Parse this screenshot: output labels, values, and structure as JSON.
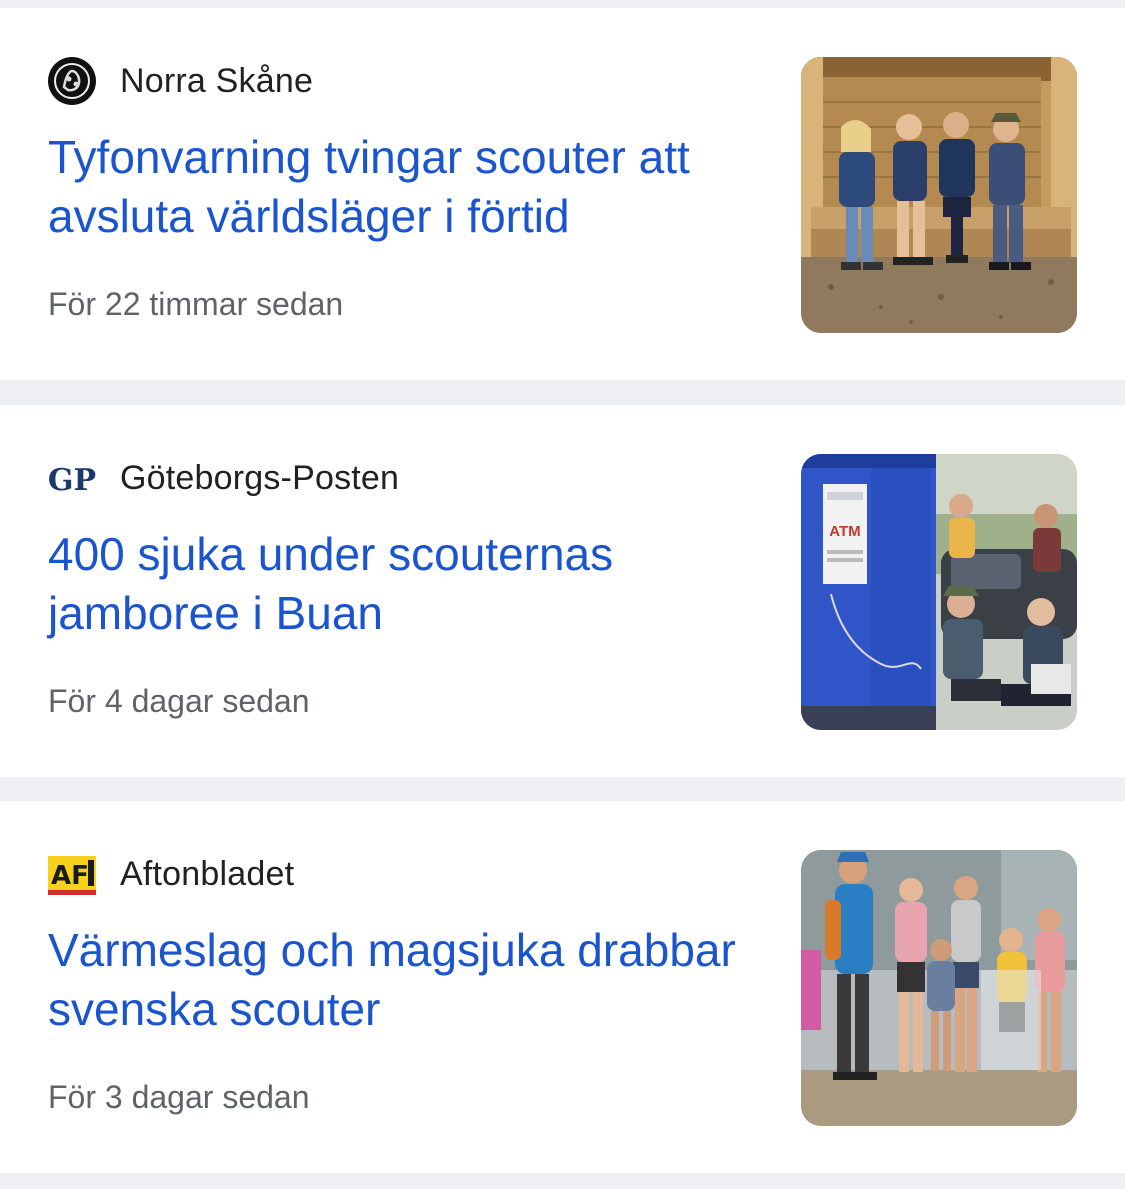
{
  "articles": [
    {
      "source": "Norra Skåne",
      "source_logo_icon": "norra-skane-logo-icon",
      "headline": "Tyfonvarning tvingar scouter att avsluta världsläger i förtid",
      "time": "För 22 timmar sedan",
      "thumbnail_icon": "scouts-sitting-photo"
    },
    {
      "source": "Göteborgs-Posten",
      "source_logo_icon": "gp-logo-icon",
      "source_logo_text": "GP",
      "headline": "400 sjuka under scouternas jamboree i Buan",
      "time": "För 4 dagar sedan",
      "thumbnail_icon": "scouts-atm-photo",
      "thumbnail_text": "ATM"
    },
    {
      "source": "Aftonbladet",
      "source_logo_icon": "aftonbladet-logo-icon",
      "source_logo_text": "AF",
      "headline": "Värmeslag och magsjuka drabbar svenska scouter",
      "time": "För 3 dagar sedan",
      "thumbnail_icon": "scouts-crowd-photo"
    }
  ],
  "colors": {
    "headline": "#1a55cf",
    "source": "#202124",
    "timestamp": "#5f6368",
    "separator": "#eef0f3"
  }
}
